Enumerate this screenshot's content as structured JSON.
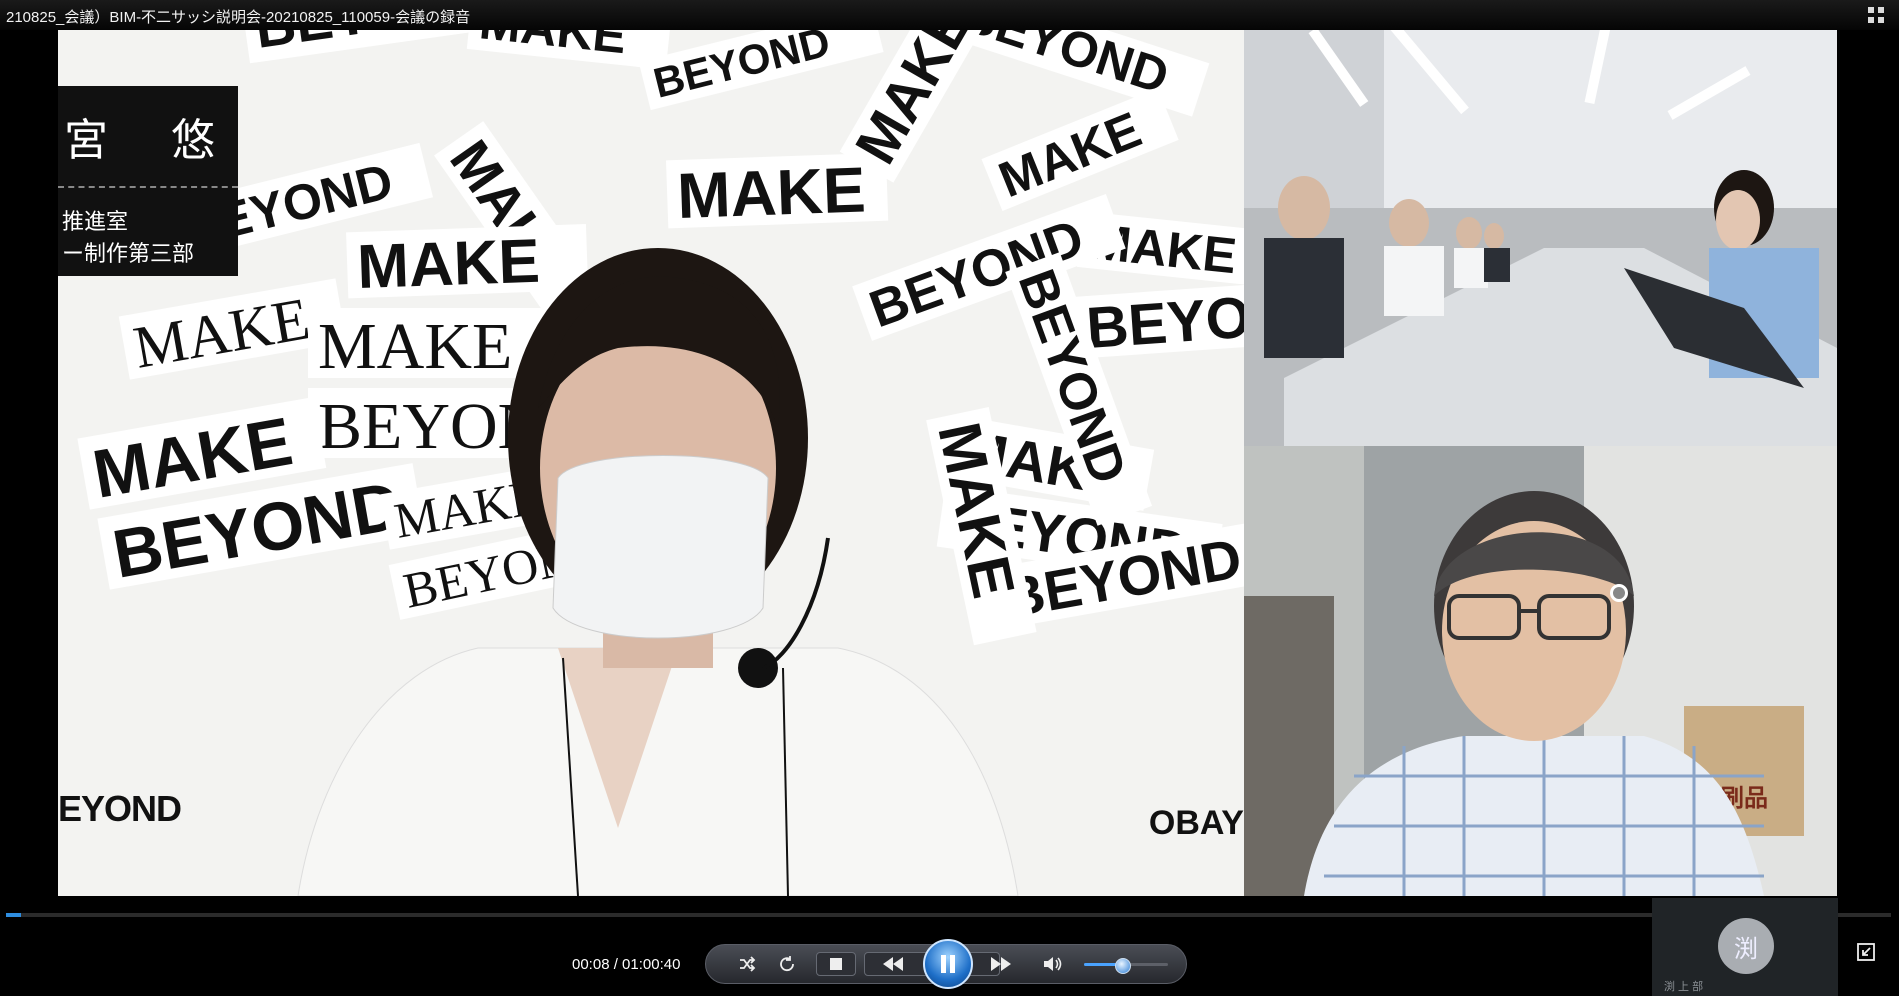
{
  "window": {
    "title": "210825_会議）BIM-不二サッシ説明会-20210825_110059-会議の録音"
  },
  "main_video": {
    "name_card": {
      "name": "宮 悠",
      "line1": "推進室",
      "line2": "ー制作第三部"
    },
    "background_words": [
      "MAKE",
      "BEYOND"
    ],
    "corner_left_text": "EYOND",
    "corner_right_text": "OBAY"
  },
  "bottom_right_tile": {
    "box_label": "印刷品"
  },
  "player": {
    "time_display": "00:08 / 01:00:40",
    "progress_fraction": 0.002,
    "volume_fraction": 0.45,
    "accent_color": "#2e8de0"
  },
  "side_panel": {
    "avatar_text": "渕",
    "caption": "渕 上 部"
  },
  "icons": {
    "compact_view": "compact-view-icon",
    "shuffle": "shuffle-icon",
    "repeat": "repeat-icon",
    "stop": "stop-icon",
    "previous": "previous-icon",
    "pause": "pause-icon",
    "next": "next-icon",
    "volume": "volume-icon",
    "popout": "popout-icon"
  }
}
